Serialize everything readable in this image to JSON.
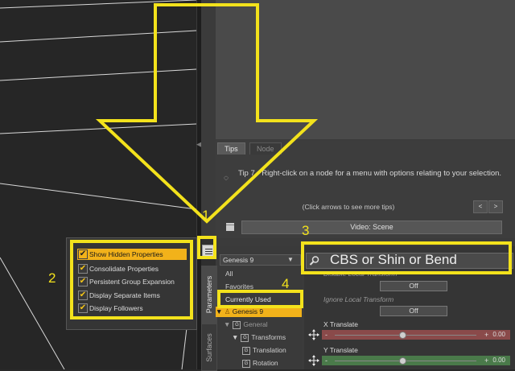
{
  "tips": {
    "tabs": [
      "Tips",
      "Node"
    ],
    "body": "Tip 7 - Right-click on a node for a menu with options relating to your selection.",
    "hint": "(Click arrows to see more tips)",
    "prev": "<",
    "next": ">",
    "video_button": "Video: Scene"
  },
  "side_tabs": [
    "Parameters",
    "Surfaces"
  ],
  "figure_select": {
    "value": "Genesis 9",
    "arrow": "▼"
  },
  "tree": {
    "all": "All",
    "favorites": "Favorites",
    "currently_used": "Currently Used",
    "genesis": "Genesis 9",
    "general": "General",
    "transforms": "Transforms",
    "translation": "Translation",
    "rotation": "Rotation"
  },
  "search": {
    "value": "CBS or Shin or Bend"
  },
  "properties": [
    {
      "name": "Disable Local Transform",
      "button": "Off"
    },
    {
      "name": "Ignore Local Transform",
      "button": "Off"
    }
  ],
  "sliders": [
    {
      "name": "X Translate",
      "value": "0.00",
      "color": "#8a4a4a"
    },
    {
      "name": "Y Translate",
      "value": "0.00",
      "color": "#4a7a4a"
    }
  ],
  "popup_menu": [
    {
      "label": "Show Hidden Properties",
      "checked": true,
      "highlighted": true
    },
    {
      "label": "Consolidate Properties",
      "checked": true
    },
    {
      "label": "Persistent Group Expansion",
      "checked": true
    },
    {
      "label": "Display Separate Items",
      "checked": true
    },
    {
      "label": "Display Followers",
      "checked": true
    }
  ],
  "annotations": {
    "n1": "1",
    "n2": "2",
    "n3": "3",
    "n4": "4",
    "color": "#f3e21c"
  }
}
